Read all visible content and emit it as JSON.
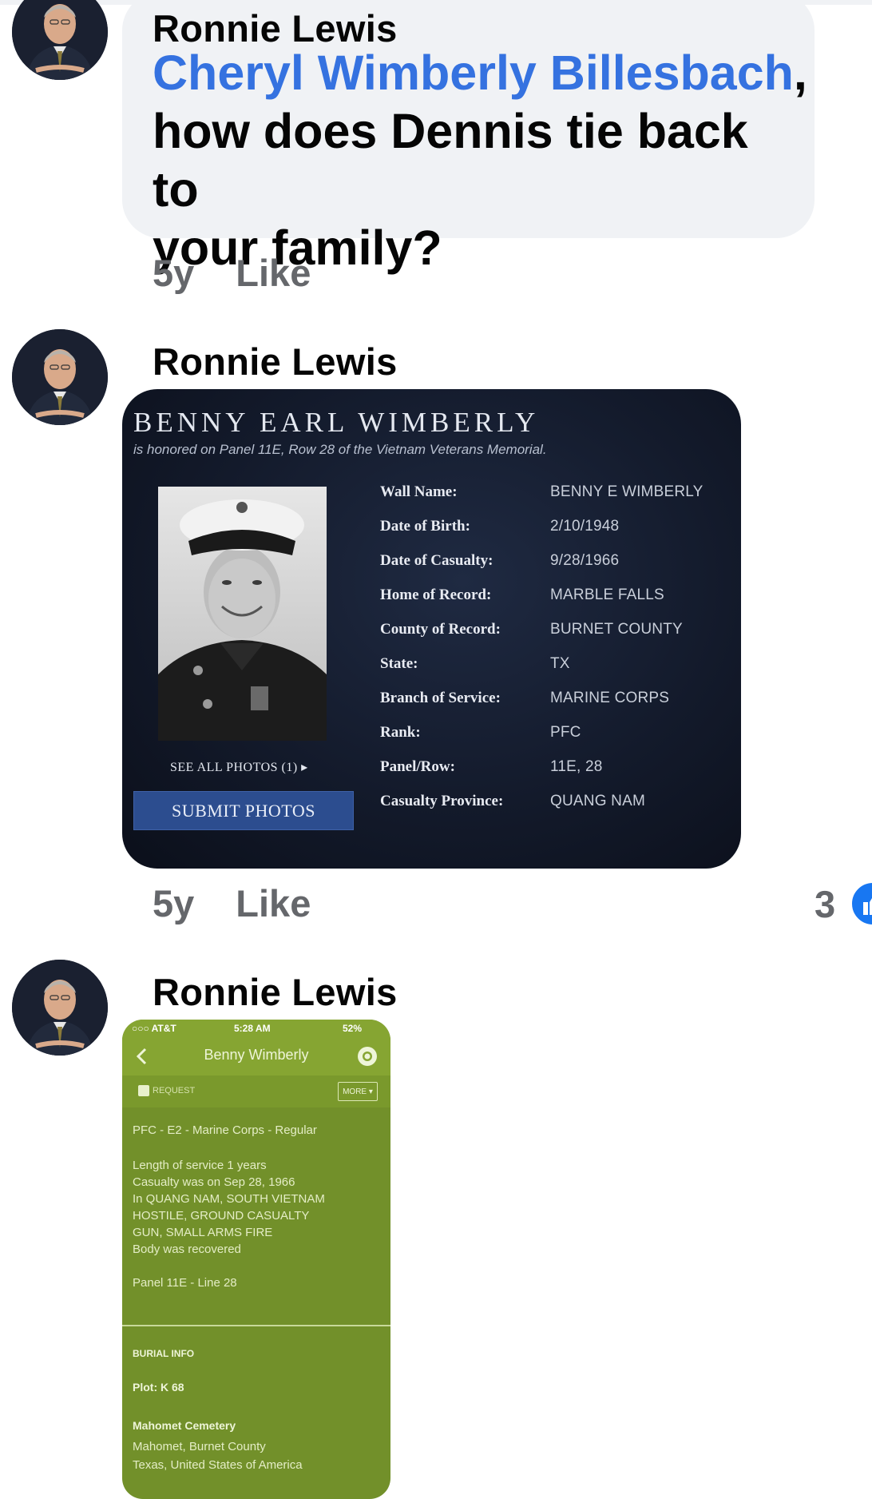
{
  "comments": [
    {
      "author": "Ronnie Lewis",
      "mention": "Cheryl Wimberly Billesbach",
      "text_after_mention": ",",
      "text_line2": "how does Dennis tie back to",
      "text_line3": "your family?",
      "time": "5y",
      "like_label": "Like"
    },
    {
      "author": "Ronnie Lewis",
      "time": "5y",
      "like_label": "Like",
      "reaction_count": "3",
      "wall_card": {
        "title": "BENNY EARL WIMBERLY",
        "subtitle": "is honored on Panel 11E, Row 28 of the Vietnam Veterans Memorial.",
        "see_all_photos": "SEE ALL PHOTOS (1) ▸",
        "submit_photos": "SUBMIT PHOTOS",
        "fields": [
          {
            "label": "Wall Name:",
            "value": "BENNY E WIMBERLY"
          },
          {
            "label": "Date of Birth:",
            "value": "2/10/1948"
          },
          {
            "label": "Date of Casualty:",
            "value": "9/28/1966"
          },
          {
            "label": "Home of Record:",
            "value": "MARBLE FALLS"
          },
          {
            "label": "County of Record:",
            "value": "BURNET COUNTY"
          },
          {
            "label": "State:",
            "value": "TX"
          },
          {
            "label": "Branch of Service:",
            "value": "MARINE CORPS"
          },
          {
            "label": "Rank:",
            "value": "PFC"
          },
          {
            "label": "Panel/Row:",
            "value": "11E, 28"
          },
          {
            "label": "Casualty Province:",
            "value": "QUANG NAM"
          }
        ]
      }
    },
    {
      "author": "Ronnie Lewis",
      "phone": {
        "carrier": "○○○ AT&T",
        "clock": "5:28 AM",
        "battery": "52%",
        "title": "Benny Wimberly",
        "request_label": "REQUEST",
        "more_label": "MORE ▾",
        "summary": "PFC - E2 - Marine Corps - Regular",
        "details": [
          "Length of service 1 years",
          "Casualty was on Sep 28, 1966",
          "In QUANG NAM, SOUTH VIETNAM",
          "HOSTILE, GROUND CASUALTY",
          "GUN, SMALL ARMS FIRE",
          "Body was recovered"
        ],
        "panel_line": "Panel 11E - Line 28",
        "burial_heading": "BURIAL INFO",
        "plot": "Plot: K 68",
        "cemetery": "Mahomet Cemetery",
        "cemetery_location_1": "Mahomet, Burnet County",
        "cemetery_location_2": "Texas, United States of America"
      }
    }
  ],
  "icons": {
    "avatar": "profile-photo",
    "back": "chevron-left-icon",
    "camera": "camera-icon",
    "like_reaction": "thumbs-up-icon"
  },
  "colors": {
    "mention": "#3572e0",
    "bubble": "#f0f2f5",
    "meta": "#65676b",
    "phone_green": "#72902a",
    "submit_button": "#2c4d8f",
    "reaction": "#1877f2"
  }
}
